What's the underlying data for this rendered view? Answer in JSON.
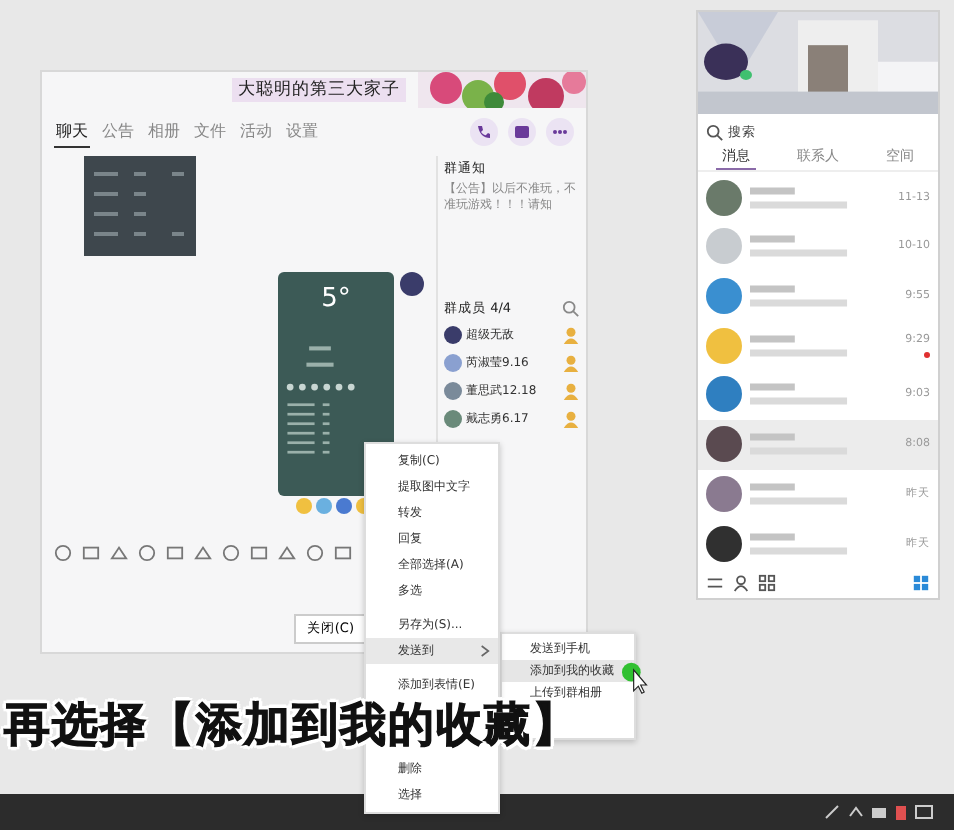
{
  "chat_window": {
    "title": "大聪明的第三大家子",
    "tabs": [
      {
        "label": "聊天",
        "selected": true
      },
      {
        "label": "公告",
        "selected": false
      },
      {
        "label": "相册",
        "selected": false
      },
      {
        "label": "文件",
        "selected": false
      },
      {
        "label": "活动",
        "selected": false
      },
      {
        "label": "设置",
        "selected": false
      }
    ],
    "notice": {
      "title": "群通知",
      "text": "【公告】以后不准玩，不准玩游戏！！！请知"
    },
    "members": {
      "title": "群成员 4/4",
      "items": [
        {
          "name": "超级无敌"
        },
        {
          "name": "芮淑莹9.16"
        },
        {
          "name": "董思武12.18"
        },
        {
          "name": "戴志勇6.17"
        }
      ]
    },
    "weather": "5°",
    "close_button": "关闭(C)"
  },
  "context_menu": {
    "items": [
      {
        "label": "复制(C)",
        "submenu": false,
        "selected": false
      },
      {
        "label": "提取图中文字",
        "submenu": false,
        "selected": false
      },
      {
        "label": "转发",
        "submenu": false,
        "selected": false
      },
      {
        "label": "回复",
        "submenu": false,
        "selected": false
      },
      {
        "label": "全部选择(A)",
        "submenu": false,
        "selected": false
      },
      {
        "label": "多选",
        "submenu": false,
        "selected": false
      },
      {
        "label": "另存为(S)...",
        "submenu": false,
        "selected": false
      },
      {
        "label": "发送到",
        "submenu": true,
        "selected": true
      },
      {
        "label": "添加到表情(E)",
        "submenu": false,
        "selected": false
      }
    ],
    "bottom_items": [
      {
        "label": "删除"
      },
      {
        "label": "选择"
      }
    ],
    "submenu": [
      {
        "label": "发送到手机",
        "selected": false
      },
      {
        "label": "添加到我的收藏",
        "selected": true
      },
      {
        "label": "上传到群相册",
        "selected": false
      }
    ]
  },
  "caption": "再选择【添加到我的收藏】",
  "main_panel": {
    "search": {
      "placeholder": "搜索"
    },
    "tabs": [
      {
        "label": "消息",
        "selected": true
      },
      {
        "label": "联系人",
        "selected": false
      },
      {
        "label": "空间",
        "selected": false
      }
    ],
    "conversations": [
      {
        "time": "11-13",
        "unread": false,
        "selected": false
      },
      {
        "time": "10-10",
        "unread": false,
        "selected": false
      },
      {
        "time": "9:55",
        "unread": false,
        "selected": false
      },
      {
        "time": "9:29",
        "unread": true,
        "selected": false
      },
      {
        "time": "9:03",
        "unread": false,
        "selected": false
      },
      {
        "time": "8:08",
        "unread": false,
        "selected": true
      },
      {
        "time": "昨天",
        "unread": false,
        "selected": false
      },
      {
        "time": "昨天",
        "unread": false,
        "selected": false
      }
    ]
  }
}
